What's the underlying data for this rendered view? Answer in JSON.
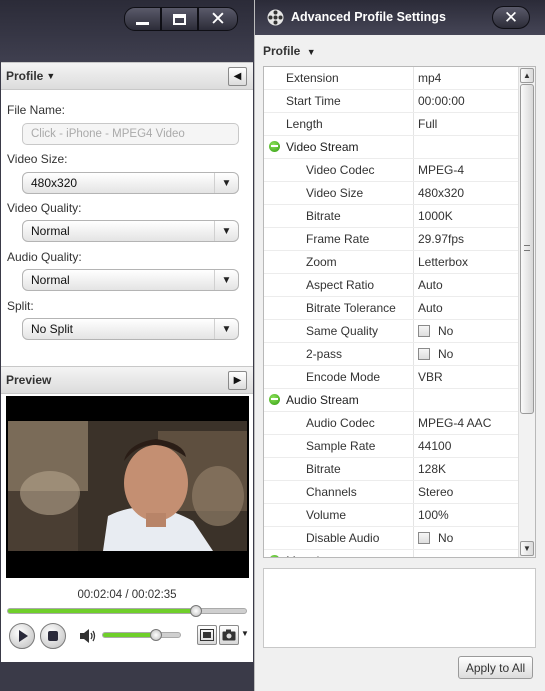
{
  "left_panel": {
    "profile_header": "Profile",
    "file_name_label": "File Name:",
    "file_name_placeholder": "Click - iPhone - MPEG4 Video",
    "video_size_label": "Video Size:",
    "video_size_value": "480x320",
    "video_quality_label": "Video Quality:",
    "video_quality_value": "Normal",
    "audio_quality_label": "Audio Quality:",
    "audio_quality_value": "Normal",
    "split_label": "Split:",
    "split_value": "No Split",
    "preview_header": "Preview",
    "time_display": "00:02:04 / 00:02:35",
    "seek_progress": 0.79,
    "volume_level": 0.69
  },
  "right_panel": {
    "title": "Advanced Profile Settings",
    "profile_header": "Profile",
    "rows": [
      {
        "name": "Extension",
        "value": "mp4",
        "level": 1
      },
      {
        "name": "Start Time",
        "value": "00:00:00",
        "level": 1
      },
      {
        "name": "Length",
        "value": "Full",
        "level": 1
      },
      {
        "name": "Video Stream",
        "value": "",
        "level": 0,
        "group": true
      },
      {
        "name": "Video Codec",
        "value": "MPEG-4",
        "level": 2
      },
      {
        "name": "Video Size",
        "value": "480x320",
        "level": 2
      },
      {
        "name": "Bitrate",
        "value": "1000K",
        "level": 2
      },
      {
        "name": "Frame Rate",
        "value": "29.97fps",
        "level": 2
      },
      {
        "name": "Zoom",
        "value": "Letterbox",
        "level": 2
      },
      {
        "name": "Aspect Ratio",
        "value": "Auto",
        "level": 2
      },
      {
        "name": "Bitrate Tolerance",
        "value": "Auto",
        "level": 2
      },
      {
        "name": "Same Quality",
        "value": "No",
        "level": 2,
        "checkbox": true
      },
      {
        "name": "2-pass",
        "value": "No",
        "level": 2,
        "checkbox": true
      },
      {
        "name": "Encode Mode",
        "value": "VBR",
        "level": 2
      },
      {
        "name": "Audio Stream",
        "value": "",
        "level": 0,
        "group": true
      },
      {
        "name": "Audio Codec",
        "value": "MPEG-4 AAC",
        "level": 2
      },
      {
        "name": "Sample Rate",
        "value": "44100",
        "level": 2
      },
      {
        "name": "Bitrate",
        "value": "128K",
        "level": 2
      },
      {
        "name": "Channels",
        "value": "Stereo",
        "level": 2
      },
      {
        "name": "Volume",
        "value": "100%",
        "level": 2
      },
      {
        "name": "Disable Audio",
        "value": "No",
        "level": 2,
        "checkbox": true
      },
      {
        "name": "Metadata",
        "value": "",
        "level": 0,
        "group": true
      }
    ],
    "apply_button": "Apply to All"
  },
  "icons": {
    "minimize": "minimize-icon",
    "maximize": "maximize-icon",
    "close": "close-icon",
    "play": "play-icon",
    "stop": "stop-icon",
    "volume": "volume-icon",
    "snapshot": "snapshot-icon",
    "camera": "camera-icon"
  },
  "colors": {
    "accent_green": "#6fcf2a",
    "titlebar_dark": "#2b2b38"
  }
}
